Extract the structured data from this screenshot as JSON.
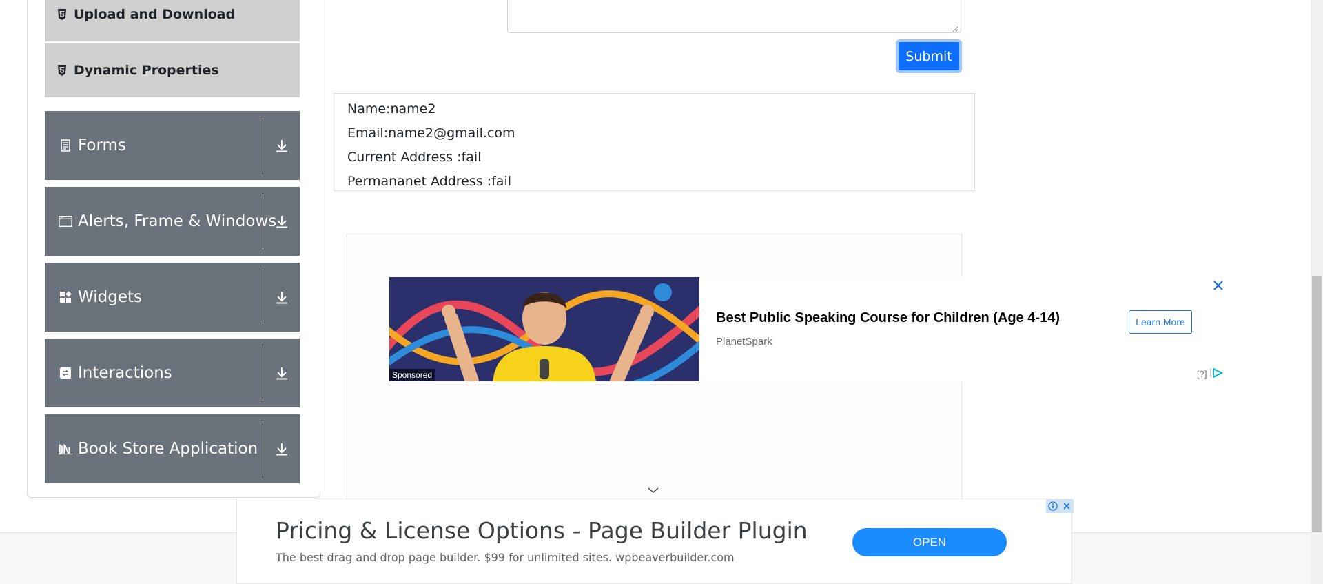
{
  "sidebar": {
    "sub_items": [
      {
        "label": "Upload and Download",
        "icon": "html5-icon"
      },
      {
        "label": "Dynamic Properties",
        "icon": "html5-icon"
      }
    ],
    "groups": [
      {
        "label": "Forms",
        "icon": "document-icon"
      },
      {
        "label": "Alerts, Frame & Windows",
        "icon": "window-icon"
      },
      {
        "label": "Widgets",
        "icon": "widgets-icon"
      },
      {
        "label": "Interactions",
        "icon": "interactions-icon"
      },
      {
        "label": "Book Store Application",
        "icon": "books-icon"
      }
    ]
  },
  "form": {
    "submit_label": "Submit"
  },
  "output": {
    "name": "Name:name2",
    "email": "Email:name2@gmail.com",
    "current_address": "Current Address :fail",
    "permanent_address": "Permananet Address :fail"
  },
  "ad": {
    "sponsored": "Sponsored",
    "title": "Best Public Speaking Course for Children (Age 4-14)",
    "brand": "PlanetSpark",
    "cta": "Learn More",
    "choices": "[?]"
  },
  "bottom_ad": {
    "title": "Pricing & License Options - Page Builder Plugin",
    "description": "The best drag and drop page builder. $99 for unlimited sites. wpbeaverbuilder.com",
    "cta": "OPEN"
  },
  "colors": {
    "primary": "#0d6efd",
    "sidebar_group": "#6a727c",
    "sidebar_sub": "#d0d0d0",
    "ad_blue": "#1a8cff"
  }
}
